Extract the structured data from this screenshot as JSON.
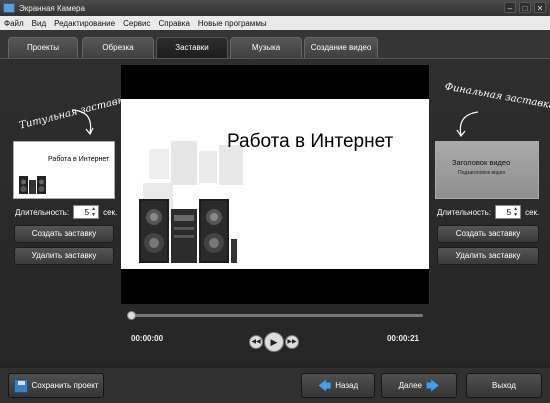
{
  "window": {
    "title": "Экранная Камера",
    "btn_min": "–",
    "btn_max": "□",
    "btn_close": "✕"
  },
  "menu": [
    "Файл",
    "Вид",
    "Редактирование",
    "Сервис",
    "Справка",
    "Новые программы"
  ],
  "tabs": [
    "Проекты",
    "Обрезка",
    "Заставки",
    "Музыка",
    "Создание видео"
  ],
  "active_tab": "Заставки",
  "left_panel": {
    "title": "Титульная заставка",
    "thumb_text": "Работа в Интернет",
    "duration_label": "Длительность:",
    "duration_value": "5",
    "duration_unit": "сек.",
    "create_button": "Создать заставку",
    "delete_button": "Удалить заставку"
  },
  "right_panel": {
    "title": "Финальная заставка",
    "thumb_heading": "Заголовок видео",
    "thumb_subheading": "Подзаголовок видео",
    "duration_label": "Длительность:",
    "duration_value": "5",
    "duration_unit": "сек.",
    "create_button": "Создать заставку",
    "delete_button": "Удалить заставку"
  },
  "preview": {
    "text": "Работа в Интернет",
    "time_current": "00:00:00",
    "time_total": "00:00:21",
    "progress": 0
  },
  "bottom": {
    "save_button": "Сохранить проект",
    "back_button": "Назад",
    "next_button": "Далее",
    "exit_button": "Выход"
  },
  "colors": {
    "accent": "#3da0f0",
    "background": "#2e2e2e"
  }
}
